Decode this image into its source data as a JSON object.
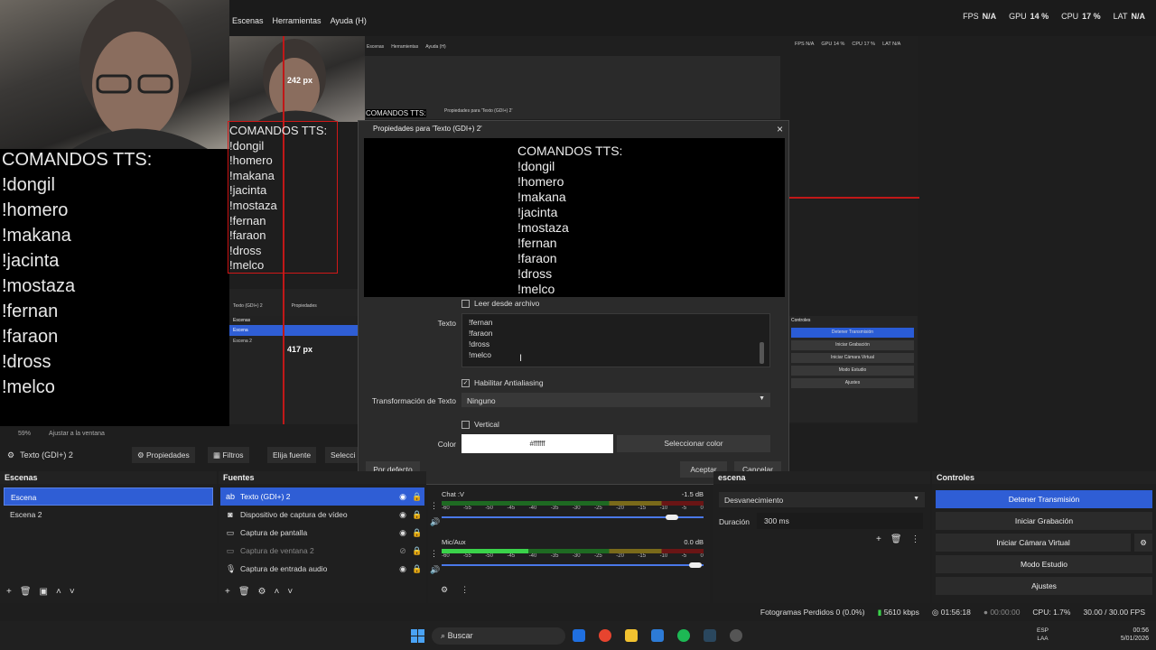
{
  "menu": [
    "Escenas",
    "Herramientas",
    "Ayuda (H)"
  ],
  "stats": [
    {
      "label": "FPS",
      "value": "N/A"
    },
    {
      "label": "GPU",
      "value": "14 %"
    },
    {
      "label": "CPU",
      "value": "17 %"
    },
    {
      "label": "LAT",
      "value": "N/A"
    }
  ],
  "preview": {
    "commands_title": "COMANDOS TTS:",
    "commands": [
      "!dongil",
      "!homero",
      "!makana",
      "!jacinta",
      "!mostaza",
      "!fernan",
      "!faraon",
      "!dross",
      "!melco"
    ],
    "px_top": "242 px",
    "px_left": "417 px",
    "mini_texto": "Texto (GDI+) 2",
    "mini_propiedades": "Propiedades",
    "mini_escenas": "Escenas",
    "mini_scenes": [
      "Escena",
      "Escena 2"
    ],
    "nested_menu": [
      "Escenas",
      "Herramientas",
      "Ayuda (H)"
    ],
    "nested_stats": [
      "FPS N/A",
      "GPU 14 %",
      "CPU 17 %",
      "LAT N/A"
    ],
    "nested_props_title": "Propiedades para 'Texto (GDI+) 2'",
    "mini_controls": [
      "Detener Transmisión",
      "Iniciar Grabación",
      "Iniciar Cámara Virtual",
      "Modo Estudio",
      "Ajustes"
    ],
    "mini_controls_head": "Controles",
    "zoom": "59%",
    "fit": "Ajustar a la ventana"
  },
  "dialog": {
    "title": "Propiedades para 'Texto (GDI+) 2'",
    "read_file_label": "Leer desde archivo",
    "text_label": "Texto",
    "text_lines": [
      "!fernan",
      "!faraon",
      "!dross",
      "!melco"
    ],
    "antialias_label": "Habilitar Antialiasing",
    "transform_label": "Transformación de Texto",
    "transform_value": "Ninguno",
    "vertical_label": "Vertical",
    "color_label": "Color",
    "color_value": "#ffffff",
    "color_button": "Seleccionar color",
    "default_button": "Por defecto",
    "accept_button": "Aceptar",
    "cancel_button": "Cancelar"
  },
  "source_toolbar": {
    "source_name": "Texto (GDI+) 2",
    "properties": "Propiedades",
    "filters": "Filtros",
    "choose_font": "Elija fuente",
    "select": "Selecci"
  },
  "scenes": {
    "title": "Escenas",
    "items": [
      "Escena",
      "Escena 2"
    ]
  },
  "sources": {
    "title": "Fuentes",
    "items": [
      "Texto (GDI+) 2",
      "Dispositivo de captura de vídeo",
      "Captura de pantalla",
      "Captura de ventana 2",
      "Captura de entrada audio"
    ]
  },
  "mixer": {
    "channels": [
      {
        "name": "Chat :V",
        "db": "-1.5 dB",
        "level": 0.0
      },
      {
        "name": "Mic/Aux",
        "db": "0.0 dB",
        "level": 0.33
      }
    ],
    "scale": [
      "-60",
      "-55",
      "-50",
      "-45",
      "-40",
      "-35",
      "-30",
      "-25",
      "-20",
      "-15",
      "-10",
      "-5",
      "0"
    ]
  },
  "transitions": {
    "title": "escena",
    "selected": "Desvanecimiento",
    "duration_label": "Duración",
    "duration_value": "300 ms"
  },
  "controls": {
    "title": "Controles",
    "buttons": [
      "Detener Transmisión",
      "Iniciar Grabación",
      "Iniciar Cámara Virtual",
      "Modo Estudio",
      "Ajustes"
    ]
  },
  "status": {
    "dropped": "Fotogramas Perdidos 0 (0.0%)",
    "bitrate": "5610 kbps",
    "stream_time": "01:56:18",
    "rec_time": "00:00:00",
    "cpu": "CPU: 1.7%",
    "fps": "30.00 / 30.00 FPS"
  },
  "taskbar": {
    "search": "Buscar",
    "lang1": "ESP",
    "lang2": "LAA",
    "time": "00:56",
    "date": "5/01/2026"
  }
}
